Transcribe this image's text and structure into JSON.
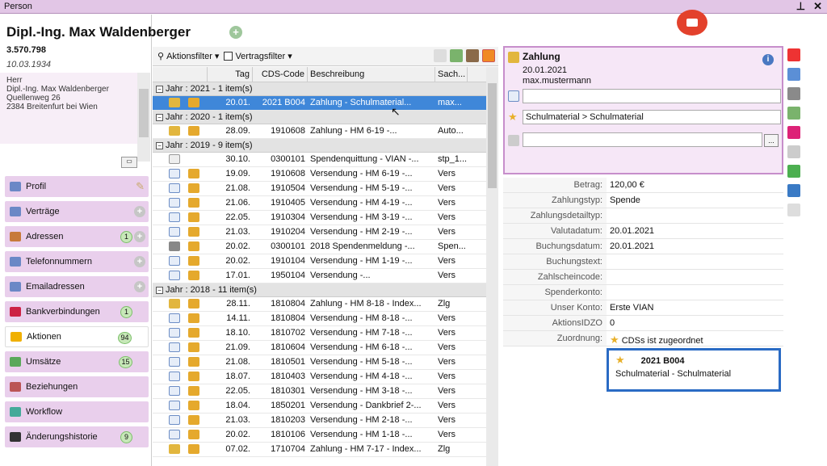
{
  "window": {
    "title": "Person",
    "pin_icon": "pin-icon",
    "close_icon": "close-icon"
  },
  "person": {
    "name": "Dipl.-Ing. Max Waldenberger",
    "number": "3.570.798",
    "birthdate": "10.03.1934",
    "address_lines": [
      "Herr",
      "Dipl.-Ing. Max Waldenberger",
      "Quellenweg 26",
      "2384 Breitenfurt bei Wien"
    ]
  },
  "nav": [
    {
      "label": "Profil",
      "icon": "user-icon",
      "action": "pencil"
    },
    {
      "label": "Verträge",
      "icon": "contract-icon",
      "action": "plus"
    },
    {
      "label": "Adressen",
      "icon": "home-icon",
      "badge": "1",
      "action": "plus"
    },
    {
      "label": "Telefonnummern",
      "icon": "phone-icon",
      "action": "plus"
    },
    {
      "label": "Emailadressen",
      "icon": "email-icon",
      "action": "plus"
    },
    {
      "label": "Bankverbindungen",
      "icon": "bank-icon",
      "badge": "1"
    },
    {
      "label": "Aktionen",
      "icon": "lightning-icon",
      "badge": "94",
      "active": true
    },
    {
      "label": "Umsätze",
      "icon": "money-icon",
      "badge": "15"
    },
    {
      "label": "Beziehungen",
      "icon": "people-icon"
    },
    {
      "label": "Workflow",
      "icon": "workflow-icon"
    },
    {
      "label": "Änderungshistorie",
      "icon": "history-icon",
      "badge": "9"
    }
  ],
  "toolbar": {
    "aktionsfilter": "Aktionsfilter",
    "vertragsfilter": "Vertragsfilter"
  },
  "grid": {
    "headers": [
      "Tag",
      "CDS-Code",
      "Beschreibung",
      "Sach..."
    ],
    "groups": [
      {
        "label": "Jahr : 2021 - 1 item(s)",
        "rows": [
          {
            "i1": "hand",
            "i2": "coin",
            "tag": "20.01.",
            "code": "2021 B004",
            "desc": "Zahlung - Schulmaterial...",
            "sach": "max...",
            "sel": true
          }
        ]
      },
      {
        "label": "Jahr : 2020 - 1 item(s)",
        "rows": [
          {
            "i1": "hand",
            "i2": "coin",
            "tag": "28.09.",
            "code": "1910608",
            "desc": "Zahlung - HM 6-19 -...",
            "sach": "Auto..."
          }
        ]
      },
      {
        "label": "Jahr : 2019 - 9 item(s)",
        "rows": [
          {
            "i1": "doc",
            "i2": "",
            "tag": "30.10.",
            "code": "0300101",
            "desc": "Spendenquittung - VIAN -...",
            "sach": "stp_1..."
          },
          {
            "i1": "mail",
            "i2": "coin",
            "tag": "19.09.",
            "code": "1910608",
            "desc": "Versendung - HM 6-19 -...",
            "sach": "Vers"
          },
          {
            "i1": "mail",
            "i2": "coin",
            "tag": "21.08.",
            "code": "1910504",
            "desc": "Versendung - HM 5-19 -...",
            "sach": "Vers"
          },
          {
            "i1": "mail",
            "i2": "coin",
            "tag": "21.06.",
            "code": "1910405",
            "desc": "Versendung - HM 4-19 -...",
            "sach": "Vers"
          },
          {
            "i1": "mail",
            "i2": "coin",
            "tag": "22.05.",
            "code": "1910304",
            "desc": "Versendung - HM 3-19 -...",
            "sach": "Vers"
          },
          {
            "i1": "mail",
            "i2": "coin",
            "tag": "21.03.",
            "code": "1910204",
            "desc": "Versendung - HM 2-19 -...",
            "sach": "Vers"
          },
          {
            "i1": "bank",
            "i2": "coin",
            "tag": "20.02.",
            "code": "0300101",
            "desc": "2018 Spendenmeldung -...",
            "sach": "Spen..."
          },
          {
            "i1": "mail",
            "i2": "coin",
            "tag": "20.02.",
            "code": "1910104",
            "desc": "Versendung - HM 1-19 -...",
            "sach": "Vers"
          },
          {
            "i1": "mail",
            "i2": "coin",
            "tag": "17.01.",
            "code": "1950104",
            "desc": "Versendung -...",
            "sach": "Vers"
          }
        ]
      },
      {
        "label": "Jahr : 2018 - 11 item(s)",
        "rows": [
          {
            "i1": "hand",
            "i2": "coin",
            "tag": "28.11.",
            "code": "1810804",
            "desc": "Zahlung - HM 8-18 - Index...",
            "sach": "Zlg"
          },
          {
            "i1": "mail",
            "i2": "coin",
            "tag": "14.11.",
            "code": "1810804",
            "desc": "Versendung - HM 8-18 -...",
            "sach": "Vers"
          },
          {
            "i1": "mail",
            "i2": "coin",
            "tag": "18.10.",
            "code": "1810702",
            "desc": "Versendung - HM 7-18 -...",
            "sach": "Vers"
          },
          {
            "i1": "mail",
            "i2": "coin",
            "tag": "21.09.",
            "code": "1810604",
            "desc": "Versendung - HM 6-18 -...",
            "sach": "Vers"
          },
          {
            "i1": "mail",
            "i2": "coin",
            "tag": "21.08.",
            "code": "1810501",
            "desc": "Versendung - HM 5-18 -...",
            "sach": "Vers"
          },
          {
            "i1": "mail",
            "i2": "coin",
            "tag": "18.07.",
            "code": "1810403",
            "desc": "Versendung - HM 4-18 -...",
            "sach": "Vers"
          },
          {
            "i1": "mail",
            "i2": "coin",
            "tag": "22.05.",
            "code": "1810301",
            "desc": "Versendung - HM 3-18 -...",
            "sach": "Vers"
          },
          {
            "i1": "mail",
            "i2": "coin",
            "tag": "18.04.",
            "code": "1850201",
            "desc": "Versendung - Dankbrief 2-...",
            "sach": "Vers"
          },
          {
            "i1": "mail",
            "i2": "coin",
            "tag": "21.03.",
            "code": "1810203",
            "desc": "Versendung - HM 2-18 -...",
            "sach": "Vers"
          },
          {
            "i1": "mail",
            "i2": "coin",
            "tag": "20.02.",
            "code": "1810106",
            "desc": "Versendung - HM 1-18 -...",
            "sach": "Vers"
          },
          {
            "i1": "hand",
            "i2": "coin",
            "tag": "07.02.",
            "code": "1710704",
            "desc": "Zahlung - HM 7-17 - Index...",
            "sach": "Zlg"
          }
        ]
      }
    ]
  },
  "detail": {
    "title": "Zahlung",
    "date": "20.01.2021",
    "user": "max.mustermann",
    "category": "Schulmaterial > Schulmaterial",
    "ellipsis": "...",
    "props": [
      {
        "label": "Betrag:",
        "value": "120,00 €"
      },
      {
        "label": "Zahlungstyp:",
        "value": "Spende"
      },
      {
        "label": "Zahlungsdetailtyp:",
        "value": ""
      },
      {
        "label": "Valutadatum:",
        "value": "20.01.2021"
      },
      {
        "label": "Buchungsdatum:",
        "value": "20.01.2021"
      },
      {
        "label": "Buchungstext:",
        "value": ""
      },
      {
        "label": "Zahlscheincode:",
        "value": ""
      },
      {
        "label": "Spenderkonto:",
        "value": ""
      },
      {
        "label": "Unser Konto:",
        "value": "Erste VIAN"
      },
      {
        "label": "AktionsIDZO",
        "value": "0"
      },
      {
        "label": "Zuordnung:",
        "value": "CDSs ist zugeordnet"
      }
    ],
    "zuordnung": {
      "code": "2021 B004",
      "desc": "Schulmaterial - Schulmaterial"
    }
  }
}
